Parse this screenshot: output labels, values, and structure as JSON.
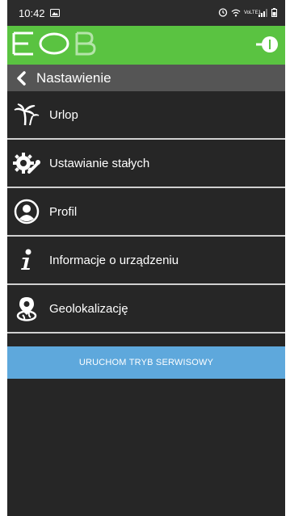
{
  "status_bar": {
    "time": "10:42",
    "network_label": "VoLTE1"
  },
  "header": {
    "logo_text": "EOB",
    "power_icon": "power-icon"
  },
  "nav": {
    "title": "Nastawienie",
    "back_icon": "chevron-left-icon"
  },
  "menu": {
    "items": [
      {
        "label": "Urlop",
        "icon": "palm-tree-icon"
      },
      {
        "label": "Ustawianie stałych",
        "icon": "gears-icon"
      },
      {
        "label": "Profil",
        "icon": "user-circle-icon"
      },
      {
        "label": "Informacje o urządzeniu",
        "icon": "info-icon"
      },
      {
        "label": "Geolokalizację",
        "icon": "geolocation-icon"
      }
    ]
  },
  "service_button": {
    "label": "URUCHOM TRYB SERWISOWY"
  },
  "colors": {
    "header_green": "#5ac341",
    "nav_gray": "#555555",
    "background": "#262626",
    "button_blue": "#5ea8dc"
  }
}
